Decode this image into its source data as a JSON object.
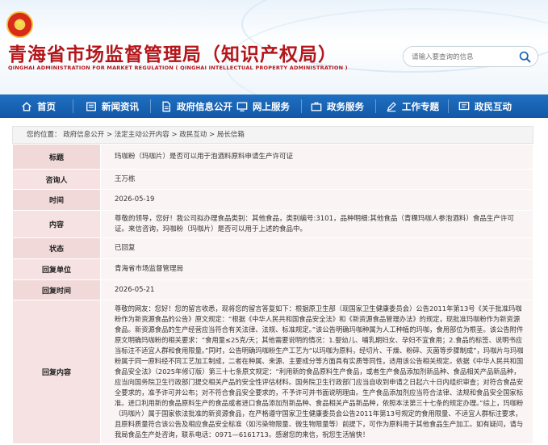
{
  "header": {
    "title": "青海省市场监督管理局（知识产权局）",
    "subtitle": "QINGHAI ADMINISTRATION FOR MARKET REGULATION ( QINGHAI INTELLECTUAL PROPERTY ADMINISTRATION )",
    "search_placeholder": "请输入要查询的信息",
    "brand_color": "#b4161a"
  },
  "nav": {
    "items": [
      {
        "label": "首页",
        "icon": "home-icon"
      },
      {
        "label": "新闻资讯",
        "icon": "news-icon"
      },
      {
        "label": "政府信息公开",
        "icon": "document-icon"
      },
      {
        "label": "网上服务",
        "icon": "monitor-icon"
      },
      {
        "label": "政务服务",
        "icon": "briefcase-icon"
      },
      {
        "label": "工作专题",
        "icon": "pencil-icon"
      },
      {
        "label": "政民互动",
        "icon": "chat-icon"
      }
    ],
    "color": "#1a64b8"
  },
  "breadcrumb": {
    "prefix": "您的位置：",
    "items": [
      "政府信息公开",
      "法定主动公开内容",
      "政民互动",
      "局长信箱"
    ],
    "separator": ">"
  },
  "detail": {
    "title_label": "标题",
    "title_value": "玛咖粉（玛咖片）是否可以用于泡酒料原料申请生产许可证",
    "asker_label": "咨询人",
    "asker_value": "王万栋",
    "time_label": "时间",
    "time_value": "2026-05-19",
    "content_label": "内容",
    "content_value": "尊敬的领导，您好！我公司拟办理食品类别：其他食品，类别编号:3101，品种明细:其他食品（青稞玛咖人参泡酒料）食品生产许可证。来信咨询，玛咖粉（玛咖片）是否可以用于上述的食品中。",
    "status_label": "状态",
    "status_value": "已回复",
    "reply_unit_label": "回复单位",
    "reply_unit_value": "青海省市场监督管理局",
    "reply_time_label": "回复时间",
    "reply_time_value": "2026-05-21",
    "reply_content_label": "回复内容",
    "reply_content_value": "尊敬的网友：您好！您的留言收悉，现将您的留言答复如下：根据原卫生部（现国家卫生健康委员会）公告2011年第13号《关于批准玛咖粉作为新资源食品的公告》原文规定：“根据《中华人民共和国食品安全法》和《新资源食品管理办法》的规定，现批准玛咖粉作为新资源食品。新资源食品的生产经营应当符合有关法律、法规、标准规定。”该公告明确玛咖种属为人工种植的玛咖，食用部位为根茎。该公告附件原文明确玛咖粉的相关要求：“食用量≤25克/天；其他需要说明的情况：1.婴幼儿、哺乳期妇女、孕妇不宜食用；2.食品的标签、说明书应当标注不适宜人群和食用限量。”同时，公告明确玛咖粉生产工艺为“以玛咖为原料，经切片、干燥、粉碎、灭菌等步骤制成”，玛咖片与玛咖粉属于同一原料经不同工艺加工制成，二者在种属、来源、主要成分等方面具有实质等同性，适用该公告相关规定。依据《中华人民共和国食品安全法》（2025年修订版）第三十七条原文规定：“利用新的食品原料生产食品，或者生产食品添加剂新品种、食品相关产品新品种，应当向国务院卫生行政部门提交相关产品的安全性评估材料。国务院卫生行政部门应当自收到申请之日起六十日内组织审查；对符合食品安全要求的，准予许可并公布；对不符合食品安全要求的，不予许可并书面说明理由。生产食品添加剂应当符合法律、法规和食品安全国家标准。进口利用新的食品原料生产的食品或者进口食品添加剂新品种、食品相关产品新品种，依照本法第三十七条的规定办理。”综上，玛咖粉（玛咖片）属于国家依法批准的新资源食品，在严格遵守国家卫生健康委员会公告2011年第13号规定的食用限量、不适宜人群标注要求，且原料质量符合该公告及相应食品安全标准（如污染物限量、微生物限量等）前提下，可作为原料用于其他食品生产加工。如有疑问，请与我局食品生产处咨询，联系电话：0971—6161713。感谢您的来信，祝您生活愉快！"
  }
}
